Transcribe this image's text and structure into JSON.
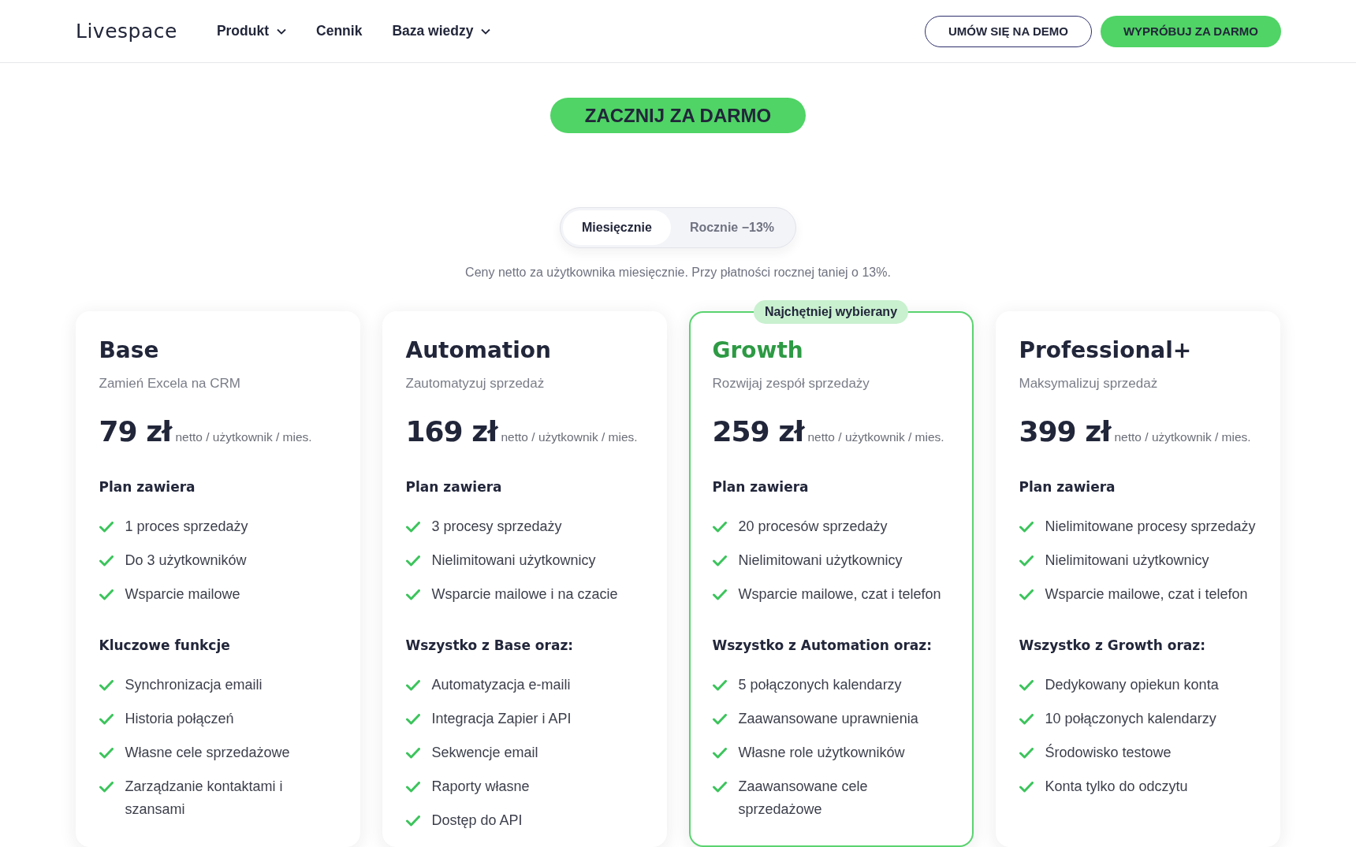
{
  "header": {
    "logo": "Livespace",
    "nav": [
      {
        "label": "Produkt",
        "dropdown": true
      },
      {
        "label": "Cennik",
        "dropdown": false
      },
      {
        "label": "Baza wiedzy",
        "dropdown": true
      }
    ],
    "buttons": [
      {
        "label": "UMÓW SIĘ NA DEMO",
        "kind": "outline"
      },
      {
        "label": "WYPRÓBUJ ZA DARMO",
        "kind": "primary"
      }
    ]
  },
  "cta": "ZACZNIJ ZA DARMO",
  "billing_toggle": [
    {
      "label": "Miesięcznie",
      "selected": true
    },
    {
      "label": "Rocznie −13%",
      "selected": false
    }
  ],
  "note": "Ceny netto za użytkownika miesięcznie. Przy płatności rocznej taniej o 13%.",
  "plans": [
    {
      "name": "Base",
      "featured": false,
      "tagline": "Zamień Excela na CRM",
      "price": "79 zł",
      "price_unit": "netto / użytkownik / mies.",
      "sections": [
        {
          "heading": "Plan zawiera",
          "items": [
            "1 proces sprzedaży",
            "Do 3 użytkowników",
            "Wsparcie mailowe"
          ]
        },
        {
          "heading": "Kluczowe funkcje",
          "items": [
            "Synchronizacja emaili",
            "Historia połączeń",
            "Własne cele sprzedażowe",
            "Zarządzanie kontaktami i szansami"
          ]
        }
      ]
    },
    {
      "name": "Automation",
      "featured": false,
      "tagline": "Zautomatyzuj sprzedaż",
      "price": "169 zł",
      "price_unit": "netto / użytkownik / mies.",
      "sections": [
        {
          "heading": "Plan zawiera",
          "items": [
            "3 procesy sprzedaży",
            "Nielimitowani użytkownicy",
            "Wsparcie mailowe i na czacie"
          ]
        },
        {
          "heading": "Wszystko z Base oraz:",
          "items": [
            "Automatyzacja e-maili",
            "Integracja Zapier i API",
            "Sekwencje email",
            "Raporty własne",
            "Dostęp do API"
          ]
        }
      ]
    },
    {
      "name": "Growth",
      "featured": true,
      "badge": "Najchętniej wybierany",
      "tagline": "Rozwijaj zespół sprzedaży",
      "price": "259 zł",
      "price_unit": "netto / użytkownik / mies.",
      "sections": [
        {
          "heading": "Plan zawiera",
          "items": [
            "20 procesów sprzedaży",
            "Nielimitowani użytkownicy",
            "Wsparcie mailowe, czat i telefon"
          ]
        },
        {
          "heading": "Wszystko z Automation oraz:",
          "items": [
            "5 połączonych kalendarzy",
            "Zaawansowane uprawnienia",
            "Własne role użytkowników",
            "Zaawansowane cele sprzedażowe"
          ]
        }
      ]
    },
    {
      "name": "Professional+",
      "featured": false,
      "tagline": "Maksymalizuj sprzedaż",
      "price": "399 zł",
      "price_unit": "netto / użytkownik / mies.",
      "sections": [
        {
          "heading": "Plan zawiera",
          "items": [
            "Nielimitowane procesy sprzedaży",
            "Nielimitowani użytkownicy",
            "Wsparcie mailowe, czat i telefon"
          ]
        },
        {
          "heading": "Wszystko z Growth oraz:",
          "items": [
            "Dedykowany opiekun konta",
            "10 połączonych kalendarzy",
            "Środowisko testowe",
            "Konta tylko do odczytu"
          ]
        }
      ]
    }
  ]
}
